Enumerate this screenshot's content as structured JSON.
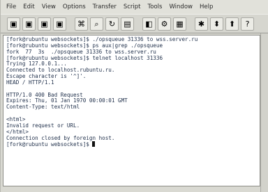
{
  "menu": [
    "File",
    "Edit",
    "View",
    "Options",
    "Transfer",
    "Script",
    "Tools",
    "Window",
    "Help"
  ],
  "toolbar_icons": [
    "new-session-icon",
    "open-session-icon",
    "save-icon",
    "print-icon",
    "connect-icon",
    "find-icon",
    "reconnect-icon",
    "copy-icon",
    "disconnect-icon",
    "screen-icon",
    "settings-icon",
    "keymap-icon",
    "sftp-icon",
    "lock-icon",
    "help-icon"
  ],
  "toolbar_glyphs": [
    "▣",
    "▣",
    "▣",
    "▣",
    "⌘",
    "⌕",
    "↻",
    "▤",
    "◧",
    "⚙",
    "▦",
    "✱",
    "⬍",
    "⬆",
    "?"
  ],
  "terminal": {
    "lines": [
      "[fork@rubuntu websockets]$ ./opsqueue 31336 to wss.server.ru",
      "[fork@rubuntu websockets]$ ps aux|grep ./opsqueue",
      "fork  77  3s  ./opsqueue 31336 to wss.server.ru",
      "[fork@rubuntu websockets]$ telnet localhost 31336",
      "Trying 127.0.0.1...",
      "Connected to localhost.rubuntu.ru.",
      "Escape character is '^]'.",
      "HEAD / HTTP/1.1",
      "",
      "HTTP/1.0 400 Bad Request",
      "Expires: Thu, 01 Jan 1970 00:00:01 GMT",
      "Content-Type: text/html",
      "",
      "<html>",
      "Invalid request or URL.",
      "</html>",
      "Connection closed by foreign host.",
      "[fork@rubuntu websockets]$"
    ]
  }
}
